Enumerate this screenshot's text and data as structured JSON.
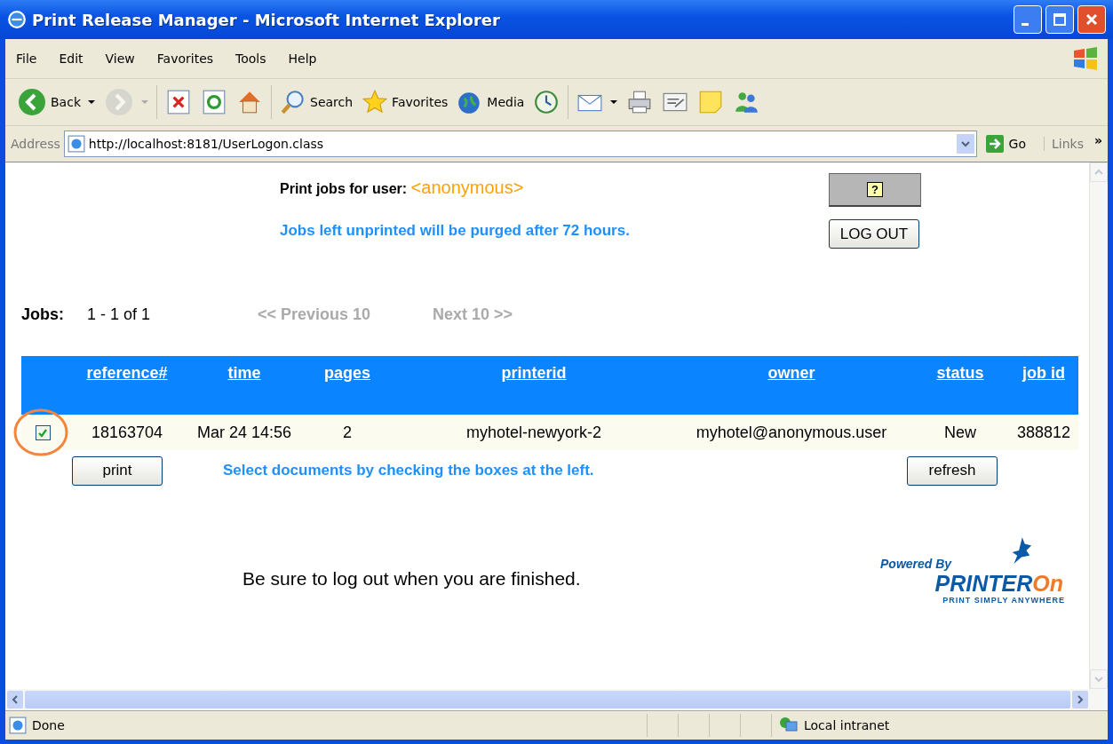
{
  "window": {
    "title": "Print Release Manager - Microsoft Internet Explorer"
  },
  "menu": [
    "File",
    "Edit",
    "View",
    "Favorites",
    "Tools",
    "Help"
  ],
  "toolbar": [
    {
      "kind": "back",
      "label": "Back",
      "dropdown": true,
      "disabled": false
    },
    {
      "kind": "forward",
      "dropdown": true,
      "disabled": true
    },
    {
      "kind": "separator"
    },
    {
      "kind": "stop",
      "disabled": false
    },
    {
      "kind": "refresh",
      "disabled": false
    },
    {
      "kind": "home",
      "disabled": false
    },
    {
      "kind": "separator"
    },
    {
      "kind": "search",
      "label": "Search",
      "disabled": false
    },
    {
      "kind": "favorites",
      "label": "Favorites",
      "disabled": false
    },
    {
      "kind": "media",
      "label": "Media",
      "disabled": false
    },
    {
      "kind": "history",
      "disabled": false
    },
    {
      "kind": "separator"
    },
    {
      "kind": "mail",
      "dropdown": true,
      "disabled": false
    },
    {
      "kind": "print",
      "disabled": false
    },
    {
      "kind": "edit",
      "disabled": false
    },
    {
      "kind": "note",
      "disabled": false
    },
    {
      "kind": "messenger",
      "disabled": false
    }
  ],
  "address": {
    "label": "Address",
    "url": "http://localhost:8181/UserLogon.class",
    "go": "Go",
    "links": "Links",
    "more": "»"
  },
  "page": {
    "user_label": "Print jobs for user:",
    "user": "<anonymous>",
    "help": "?",
    "logout": "LOG OUT",
    "purge_notice": "Jobs left unprinted will be purged after 72 hours.",
    "jobs_label": "Jobs:",
    "jobs_range": "1 - 1 of 1",
    "previous": {
      "label": "<< Previous 10",
      "disabled": true
    },
    "next": {
      "label": "Next 10 >>",
      "disabled": true
    },
    "table": {
      "columns": [
        "reference#",
        "time",
        "pages",
        "printerid",
        "owner",
        "status",
        "job id"
      ],
      "rows": [
        {
          "checked": true,
          "highlighted": true,
          "cells": [
            "18163704",
            "Mar 24 14:56",
            "2",
            "myhotel-newyork-2",
            "myhotel@anonymous.user",
            "New",
            "388812"
          ]
        }
      ]
    },
    "print": "print",
    "instruction": "Select documents by checking the boxes at the left.",
    "refresh": "refresh",
    "footer_note": "Be sure to log out when you are finished.",
    "logo": {
      "powered": "Powered By",
      "wordmark_main": "PRINTER",
      "wordmark_accent": "On",
      "tagline": "PRINT SIMPLY ANYWHERE"
    }
  },
  "status_bar": {
    "text": "Done",
    "zone": "Local intranet"
  }
}
